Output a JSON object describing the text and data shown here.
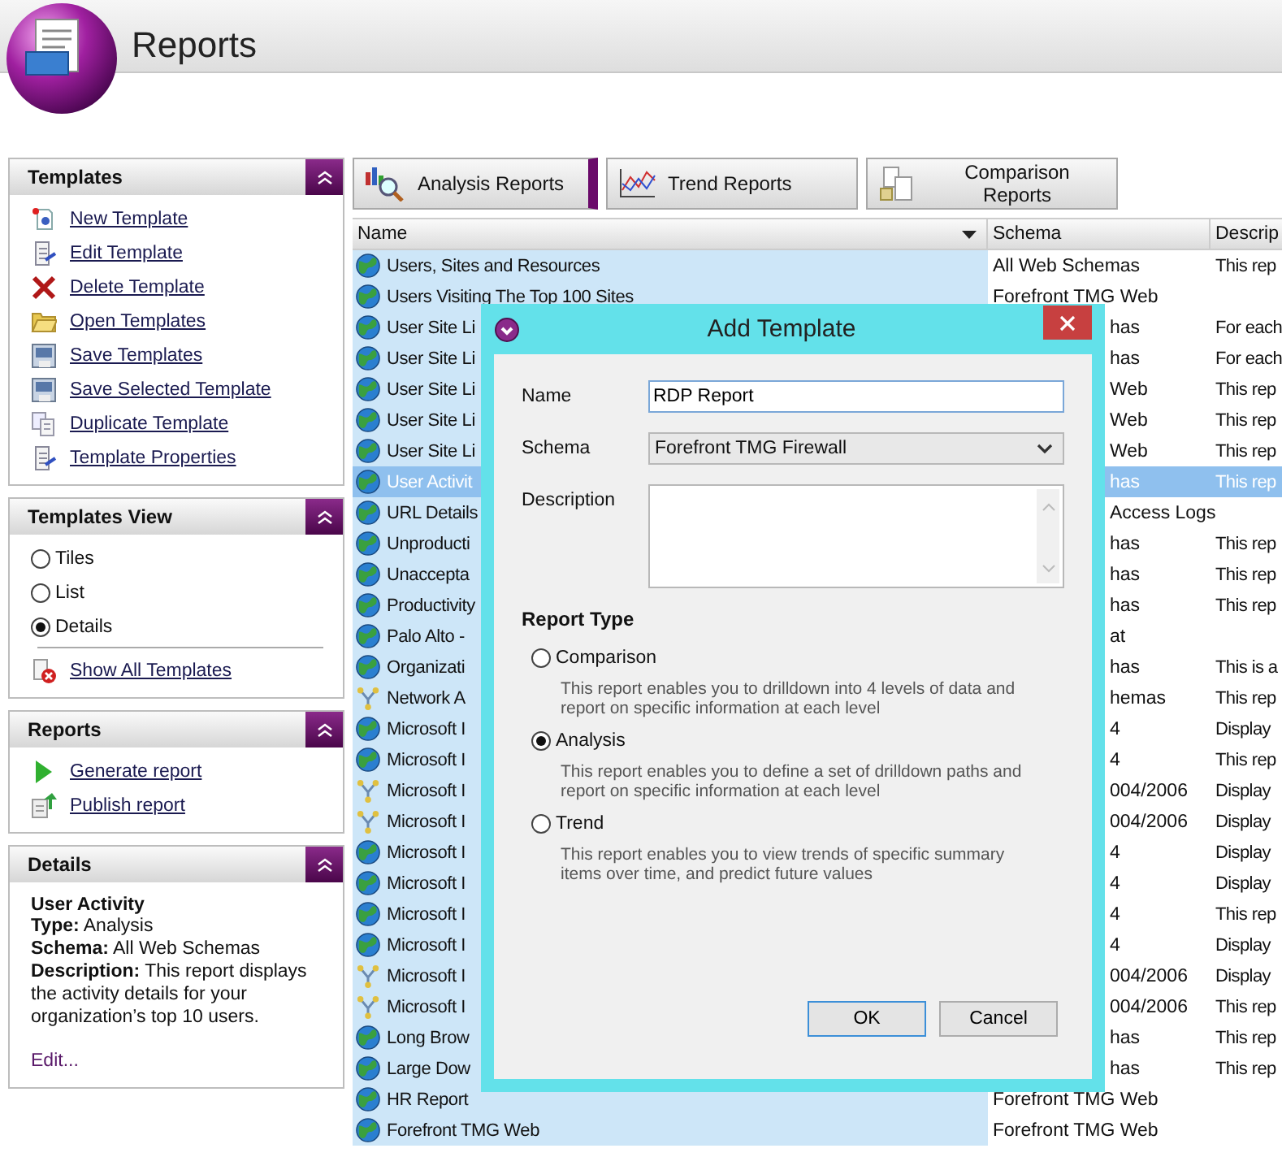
{
  "app": {
    "title": "Reports"
  },
  "sidebar": {
    "panels": [
      {
        "title": "Templates",
        "kind": "links",
        "items": [
          {
            "label": "New Template",
            "kind": "new"
          },
          {
            "label": "Edit Template",
            "kind": "edit"
          },
          {
            "label": "Delete Template",
            "kind": "delete"
          },
          {
            "label": "Open Templates",
            "kind": "open"
          },
          {
            "label": "Save Templates",
            "kind": "save"
          },
          {
            "label": "Save Selected Template",
            "kind": "save"
          },
          {
            "label": "Duplicate Template",
            "kind": "duplicate"
          },
          {
            "label": "Template Properties",
            "kind": "edit"
          }
        ]
      },
      {
        "title": "Templates View",
        "kind": "view",
        "options": [
          {
            "label": "Tiles",
            "selected": false
          },
          {
            "label": "List",
            "selected": false
          },
          {
            "label": "Details",
            "selected": true
          }
        ],
        "items": [
          {
            "label": "Show All Templates",
            "kind": "show-all"
          }
        ]
      },
      {
        "title": "Reports",
        "kind": "links",
        "items": [
          {
            "label": "Generate report",
            "kind": "generate"
          },
          {
            "label": "Publish report",
            "kind": "publish"
          }
        ]
      },
      {
        "title": "Details",
        "kind": "details",
        "heading": "User Activity",
        "lines": [
          "**Type:** Analysis",
          "**Schema:** All Web Schemas",
          "**Description:** This report displays the activity details for your organization’s top 10 users."
        ],
        "link": "Edit..."
      }
    ]
  },
  "tabs": [
    {
      "label": "Analysis Reports",
      "kind": "analysis",
      "selected": true
    },
    {
      "label": "Trend Reports",
      "kind": "trend",
      "selected": false
    },
    {
      "label": "Comparison Reports",
      "kind": "comparison",
      "selected": false
    }
  ],
  "table": {
    "columns": [
      "Name",
      "Schema",
      "Descrip"
    ],
    "rows": [
      {
        "kind": "globe",
        "name": "Users, Sites and Resources",
        "schema": "All Web Schemas",
        "description": "This rep",
        "selected": false
      },
      {
        "kind": "globe",
        "name": "Users Visiting The Top 100 Sites",
        "schema": "Forefront TMG Web",
        "selected": false
      },
      {
        "kind": "globe",
        "name": "User Site Li",
        "schema": "has",
        "description": "For each",
        "selected": false
      },
      {
        "kind": "globe",
        "name": "User Site Li",
        "schema": "has",
        "description": "For each",
        "selected": false
      },
      {
        "kind": "globe",
        "name": "User Site Li",
        "schema": "Web",
        "description": "This rep",
        "selected": false
      },
      {
        "kind": "globe",
        "name": "User Site Li",
        "schema": "Web",
        "description": "This rep",
        "selected": false
      },
      {
        "kind": "globe",
        "name": "User Site Li",
        "schema": "Web",
        "description": "This rep",
        "selected": false
      },
      {
        "kind": "globe",
        "name": "User Activit",
        "schema": "has",
        "description": "This rep",
        "selected": true
      },
      {
        "kind": "globe",
        "name": "URL Details",
        "schema": "Access Logs",
        "selected": false
      },
      {
        "kind": "globe",
        "name": "Unproducti",
        "schema": "has",
        "description": "This rep",
        "selected": false
      },
      {
        "kind": "globe",
        "name": "Unaccepta",
        "schema": "has",
        "description": "This rep",
        "selected": false
      },
      {
        "kind": "globe",
        "name": "Productivity",
        "schema": "has",
        "description": "This rep",
        "selected": false
      },
      {
        "kind": "globe",
        "name": "Palo Alto -",
        "schema": "at",
        "selected": false
      },
      {
        "kind": "globe",
        "name": "Organizati",
        "schema": "has",
        "description": "This is a",
        "selected": false
      },
      {
        "kind": "network",
        "name": "Network A",
        "schema": "hemas",
        "description": "This rep",
        "selected": false
      },
      {
        "kind": "globe",
        "name": "Microsoft I",
        "schema": "4",
        "description": "Display",
        "selected": false
      },
      {
        "kind": "globe",
        "name": "Microsoft I",
        "schema": "4",
        "description": "This rep",
        "selected": false
      },
      {
        "kind": "network",
        "name": "Microsoft I",
        "schema": "004/2006",
        "description": "Display",
        "selected": false
      },
      {
        "kind": "network",
        "name": "Microsoft I",
        "schema": "004/2006",
        "description": "Display",
        "selected": false
      },
      {
        "kind": "globe",
        "name": "Microsoft I",
        "schema": "4",
        "description": "Display",
        "selected": false
      },
      {
        "kind": "globe",
        "name": "Microsoft I",
        "schema": "4",
        "description": "Display",
        "selected": false
      },
      {
        "kind": "globe",
        "name": "Microsoft I",
        "schema": "4",
        "description": "This rep",
        "selected": false
      },
      {
        "kind": "globe",
        "name": "Microsoft I",
        "schema": "4",
        "description": "Display",
        "selected": false
      },
      {
        "kind": "network",
        "name": "Microsoft I",
        "schema": "004/2006",
        "description": "Display",
        "selected": false
      },
      {
        "kind": "network",
        "name": "Microsoft I",
        "schema": "004/2006",
        "description": "This rep",
        "selected": false
      },
      {
        "kind": "globe",
        "name": "Long Brow",
        "schema": "has",
        "description": "This rep",
        "selected": false
      },
      {
        "kind": "globe",
        "name": "Large Dow",
        "schema": "has",
        "description": "This rep",
        "selected": false
      },
      {
        "kind": "globe",
        "name": "HR Report",
        "schema": "Forefront TMG Web",
        "selected": false
      },
      {
        "kind": "globe",
        "name": "Forefront TMG Web",
        "schema": "Forefront TMG Web",
        "selected": false
      }
    ]
  },
  "dialog": {
    "title": "Add Template",
    "fields": [
      {
        "label": "Name",
        "kind": "text",
        "value": "RDP Report"
      },
      {
        "label": "Schema",
        "kind": "select",
        "value": "Forefront TMG Firewall"
      },
      {
        "label": "Description",
        "kind": "textarea"
      }
    ],
    "report_type": {
      "title": "Report Type",
      "options": [
        {
          "label": "Comparison",
          "description": "This report enables you to drilldown into 4 levels of data and report on specific information at each level",
          "selected": false
        },
        {
          "label": "Analysis",
          "description": "This report enables you to define a set of drilldown paths and report on specific information at each level",
          "selected": true
        },
        {
          "label": "Trend",
          "description": "This report enables you to view trends of specific summary items over time, and predict future values",
          "selected": false
        }
      ]
    },
    "buttons": [
      "OK",
      "Cancel"
    ]
  }
}
